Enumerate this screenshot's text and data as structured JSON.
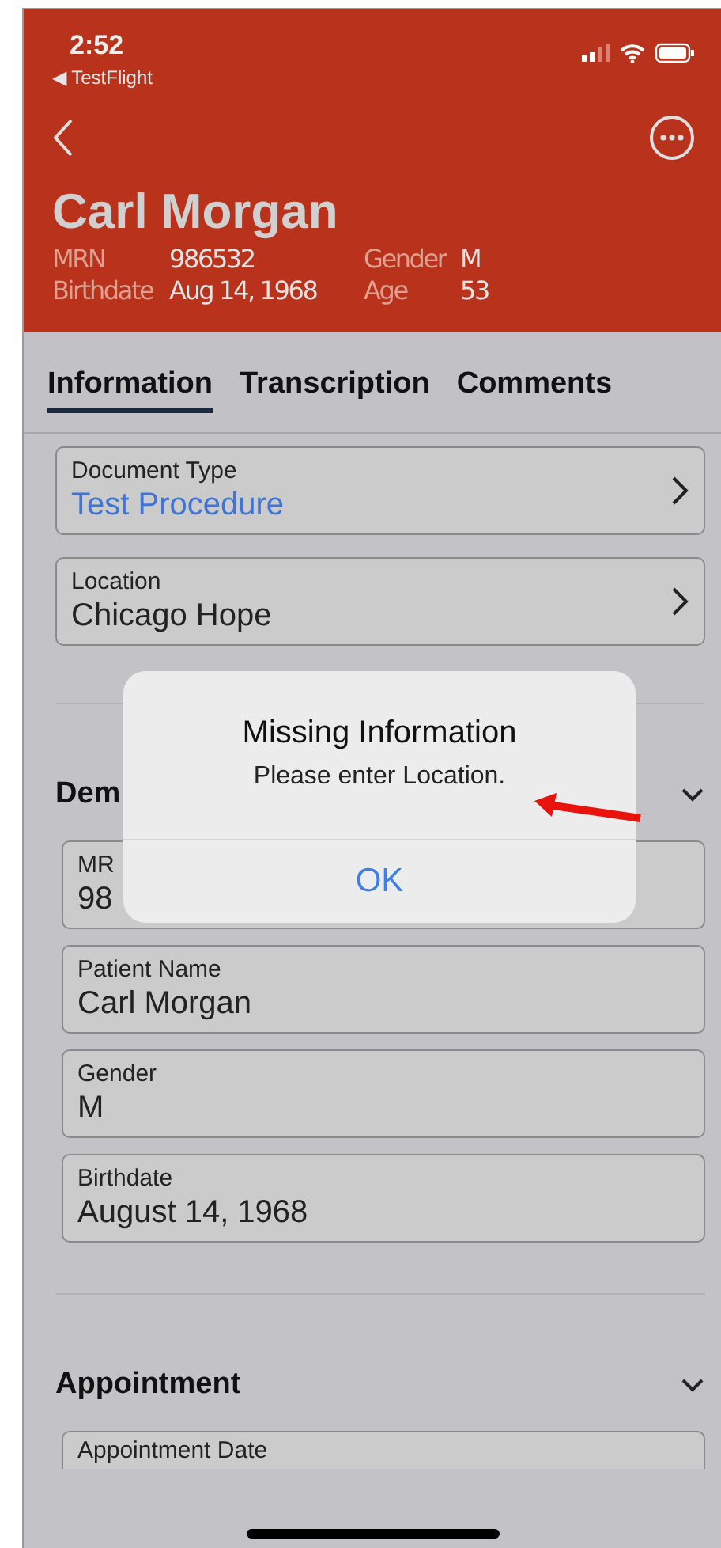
{
  "status_bar": {
    "time": "2:52",
    "back_app": "◀ TestFlight"
  },
  "header": {
    "patient_name": "Carl Morgan",
    "details": [
      {
        "label": "MRN",
        "value": "986532"
      },
      {
        "label": "Gender",
        "value": "M"
      },
      {
        "label": "Birthdate",
        "value": "Aug 14, 1968"
      },
      {
        "label": "Age",
        "value": "53"
      }
    ]
  },
  "tabs": [
    {
      "label": "Information",
      "selected": true
    },
    {
      "label": "Transcription",
      "selected": false
    },
    {
      "label": "Comments",
      "selected": false
    }
  ],
  "fields": [
    {
      "label": "Document Type",
      "value": "Test Procedure",
      "kind": "link"
    },
    {
      "label": "Location",
      "value": "Chicago Hope",
      "kind": "plain"
    }
  ],
  "sections": [
    {
      "title": "Dem",
      "fields": [
        {
          "label": "MR",
          "value": "98"
        },
        {
          "label": "Patient Name",
          "value": "Carl Morgan"
        },
        {
          "label": "Gender",
          "value": "M"
        },
        {
          "label": "Birthdate",
          "value": "August 14, 1968"
        }
      ]
    },
    {
      "title": "Appointment",
      "fields": [
        {
          "label": "Appointment Date"
        }
      ]
    }
  ],
  "dialog": {
    "title": "Missing Information",
    "message": "Please enter Location.",
    "button": "OK"
  }
}
